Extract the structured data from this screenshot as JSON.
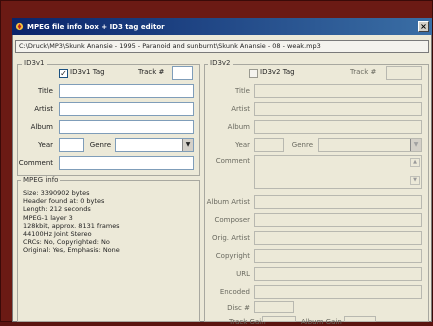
{
  "window": {
    "title": "MPEG file info box + ID3 tag editor",
    "close": "×"
  },
  "file_path": "C:\\Druck\\MP3\\Skunk Anansie - 1995 - Paranoid and sunburnt\\Skunk Anansie - 08 - weak.mp3",
  "id3v1": {
    "group_label": "ID3v1",
    "tag_checkbox_label": "ID3v1 Tag",
    "tag_checked": true,
    "track_label": "Track #",
    "title_label": "Title",
    "artist_label": "Artist",
    "album_label": "Album",
    "year_label": "Year",
    "genre_label": "Genre",
    "comment_label": "Comment"
  },
  "mpeg_info": {
    "group_label": "MPEG info",
    "lines": [
      "Size: 3390902 bytes",
      "Header found at: 0 bytes",
      "Length: 212 seconds",
      "MPEG-1 layer 3",
      "128kbit, approx. 8131 frames",
      "44100Hz Joint Stereo",
      "CRCs: No, Copyrighted: No",
      "Original: Yes, Emphasis: None"
    ]
  },
  "id3v2": {
    "group_label": "ID3v2",
    "tag_checkbox_label": "ID3v2 Tag",
    "tag_checked": false,
    "track_label": "Track #",
    "title_label": "Title",
    "artist_label": "Artist",
    "album_label": "Album",
    "year_label": "Year",
    "genre_label": "Genre",
    "comment_label": "Comment",
    "album_artist_label": "Album Artist",
    "composer_label": "Composer",
    "orig_artist_label": "Orig. Artist",
    "copyright_label": "Copyright",
    "url_label": "URL",
    "encoded_label": "Encoded",
    "disc_label": "Disc #",
    "track_gain_label": "Track Gain",
    "album_gain_label": "Album Gain"
  },
  "colors": {
    "titlebar_start": "#0a246a",
    "titlebar_end": "#3a6ea5",
    "dialog_bg": "#ece9d8",
    "desktop_bg": "#6b1a14"
  }
}
